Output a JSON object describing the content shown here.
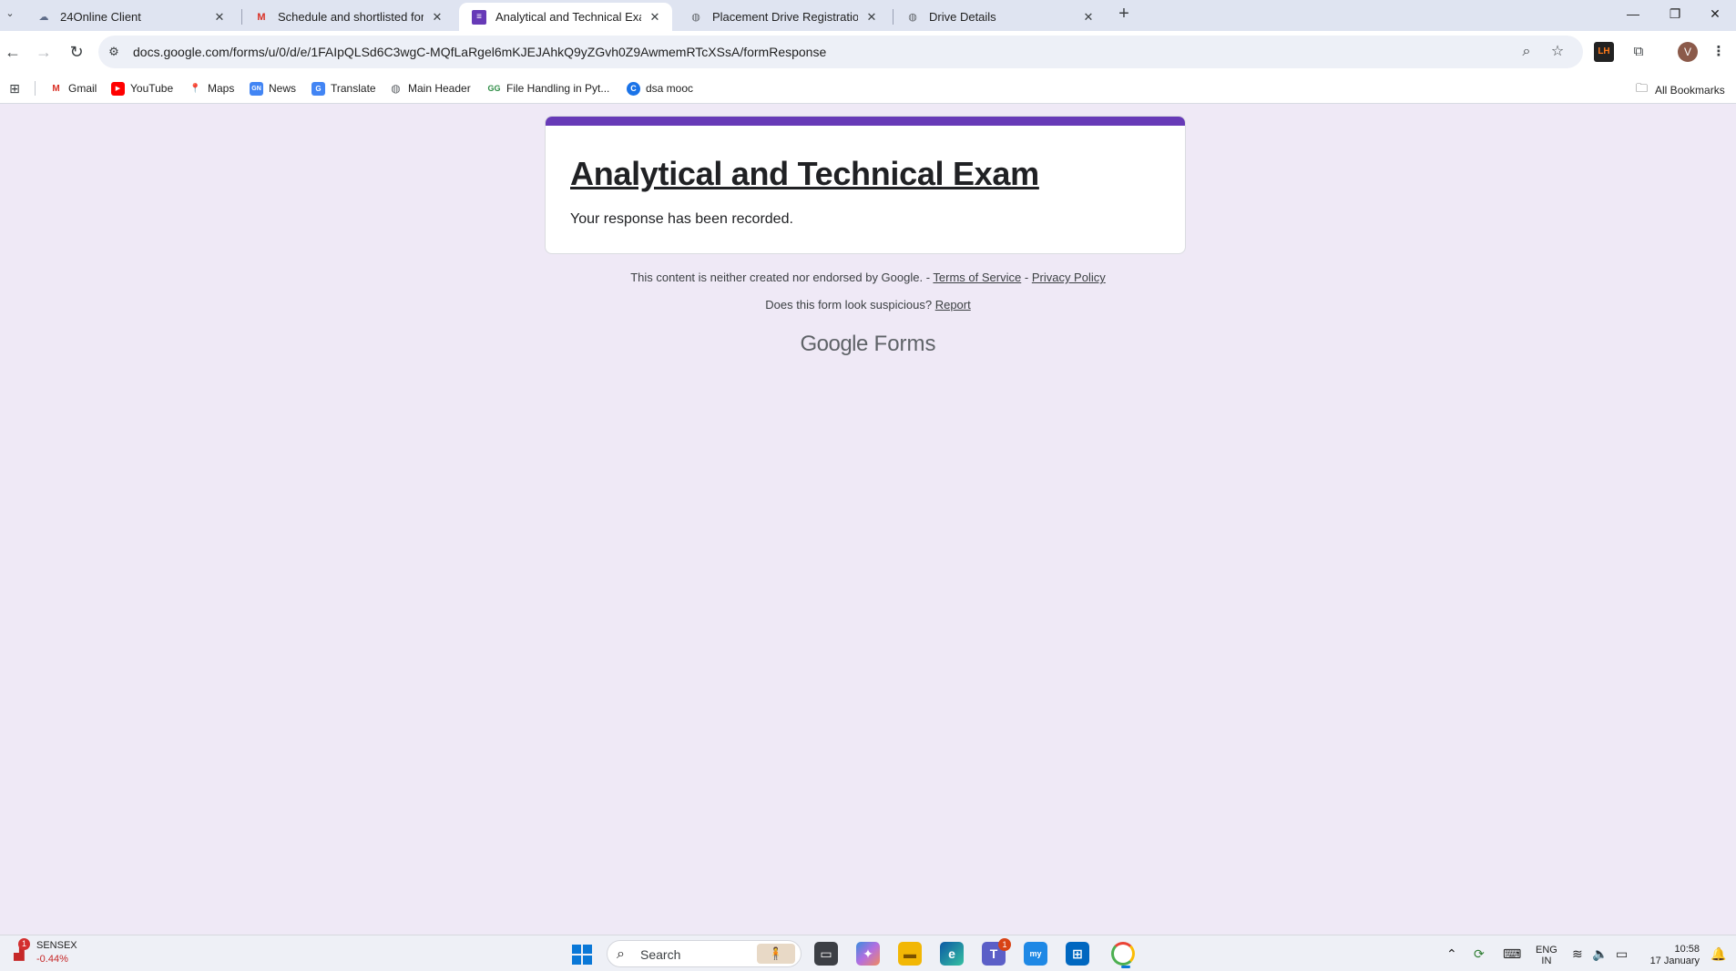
{
  "tabs": [
    {
      "title": "24Online Client",
      "favicon": "cloud-icon",
      "active": false
    },
    {
      "title": "Schedule and shortlisted for the",
      "favicon": "gmail-icon",
      "active": false
    },
    {
      "title": "Analytical and Technical Exam",
      "favicon": "forms-icon",
      "active": true
    },
    {
      "title": "Placement Drive Registration",
      "favicon": "globe-icon",
      "active": false
    },
    {
      "title": "Drive Details",
      "favicon": "globe-icon",
      "active": false
    }
  ],
  "address_bar": {
    "url": "docs.google.com/forms/u/0/d/e/1FAIpQLSd6C3wgC-MQfLaRgel6mKJEJAhkQ9yZGvh0Z9AwmemRTcXSsA/formResponse"
  },
  "profile": {
    "initial": "V"
  },
  "extension": {
    "label": "LH"
  },
  "bookmarks": [
    {
      "label": "Gmail",
      "icon": "gmail-icon"
    },
    {
      "label": "YouTube",
      "icon": "youtube-icon"
    },
    {
      "label": "Maps",
      "icon": "maps-icon"
    },
    {
      "label": "News",
      "icon": "news-icon"
    },
    {
      "label": "Translate",
      "icon": "translate-icon"
    },
    {
      "label": "Main Header",
      "icon": "globe-icon"
    },
    {
      "label": "File Handling in Pyt...",
      "icon": "geeks-icon"
    },
    {
      "label": "dsa mooc",
      "icon": "circle-c-icon"
    }
  ],
  "all_bookmarks": "All Bookmarks",
  "form": {
    "title": "Analytical and Technical Exam",
    "confirmation": "Your response has been recorded.",
    "accent_color": "#673ab7"
  },
  "footer": {
    "disclaimer": "This content is neither created nor endorsed by Google. -",
    "terms": "Terms of Service",
    "dash": "-",
    "privacy": "Privacy Policy",
    "suspicious": "Does this form look suspicious?",
    "report": "Report",
    "brand_google": "Google",
    "brand_forms": "Forms"
  },
  "taskbar": {
    "ticker_name": "SENSEX",
    "ticker_change": "-0.44%",
    "ticker_badge": "1",
    "search_placeholder": "Search",
    "teams_badge": "1",
    "lang_top": "ENG",
    "lang_bottom": "IN",
    "time": "10:58",
    "date": "17 January"
  }
}
